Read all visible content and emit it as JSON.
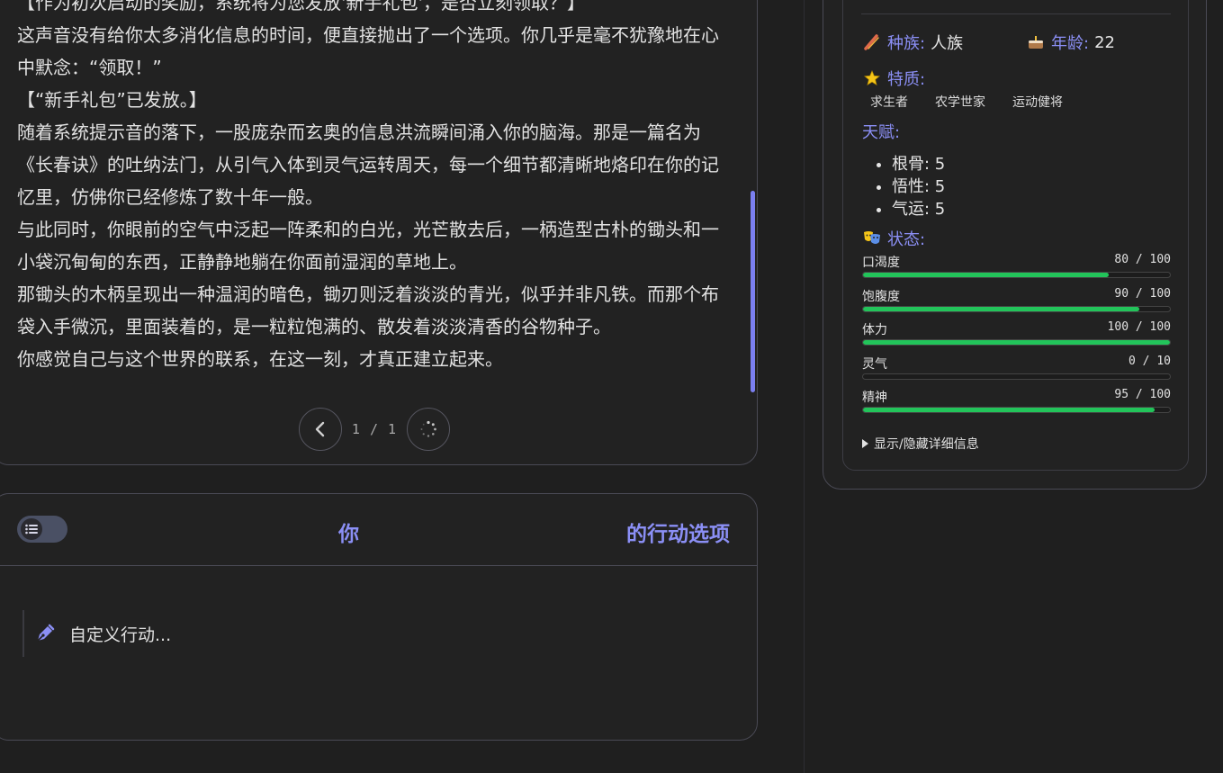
{
  "story": {
    "paragraphs": [
      "【作为初次启动的奖励，系统将为您发放'新手礼包'，是否立刻领取？】",
      "这声音没有给你太多消化信息的时间，便直接抛出了一个选项。你几乎是毫不犹豫地在心中默念：“领取！”",
      "【“新手礼包”已发放。】",
      "随着系统提示音的落下，一股庞杂而玄奥的信息洪流瞬间涌入你的脑海。那是一篇名为《长春诀》的吐纳法门，从引气入体到灵气运转周天，每一个细节都清晰地烙印在你的记忆里，仿佛你已经修炼了数十年一般。",
      "与此同时，你眼前的空气中泛起一阵柔和的白光，光芒散去后，一柄造型古朴的锄头和一小袋沉甸甸的东西，正静静地躺在你面前湿润的草地上。",
      "那锄头的木柄呈现出一种温润的暗色，锄刃则泛着淡淡的青光，似乎并非凡铁。而那个布袋入手微沉，里面装着的，是一粒粒饱满的、散发着淡淡清香的谷物种子。",
      "你感觉自己与这个世界的联系，在这一刻，才真正建立起来。"
    ],
    "pager": {
      "current_total": "1 / 1"
    }
  },
  "actions": {
    "title_part1": "你",
    "title_part2": "的行动选项",
    "custom_action_label": "自定义行动..."
  },
  "status": {
    "race_label": "种族:",
    "race_value": "人族",
    "age_label": "年龄:",
    "age_value": "22",
    "traits_label": "特质:",
    "traits": [
      "求生者",
      "农学世家",
      "运动健将"
    ],
    "talents_label": "天赋:",
    "talents": [
      "根骨: 5",
      "悟性: 5",
      "气运: 5"
    ],
    "state_label": "状态:",
    "stats": [
      {
        "name": "口渴度",
        "value": 80,
        "max": 100,
        "display": "80 / 100"
      },
      {
        "name": "饱腹度",
        "value": 90,
        "max": 100,
        "display": "90 / 100"
      },
      {
        "name": "体力",
        "value": 100,
        "max": 100,
        "display": "100 / 100"
      },
      {
        "name": "灵气",
        "value": 0,
        "max": 10,
        "display": "0 / 10"
      },
      {
        "name": "精神",
        "value": 95,
        "max": 100,
        "display": "95 / 100"
      }
    ],
    "details_toggle": "显示/隐藏详细信息"
  },
  "colors": {
    "accent": "#8b8ff5",
    "bar_fill": "#22c45a",
    "background": "#1f1f1f"
  },
  "icons": [
    "chevron-left-icon",
    "loading-spinner-icon",
    "list-icon",
    "pen-icon",
    "ribbon-icon",
    "cake-icon",
    "star-icon",
    "masks-icon"
  ]
}
